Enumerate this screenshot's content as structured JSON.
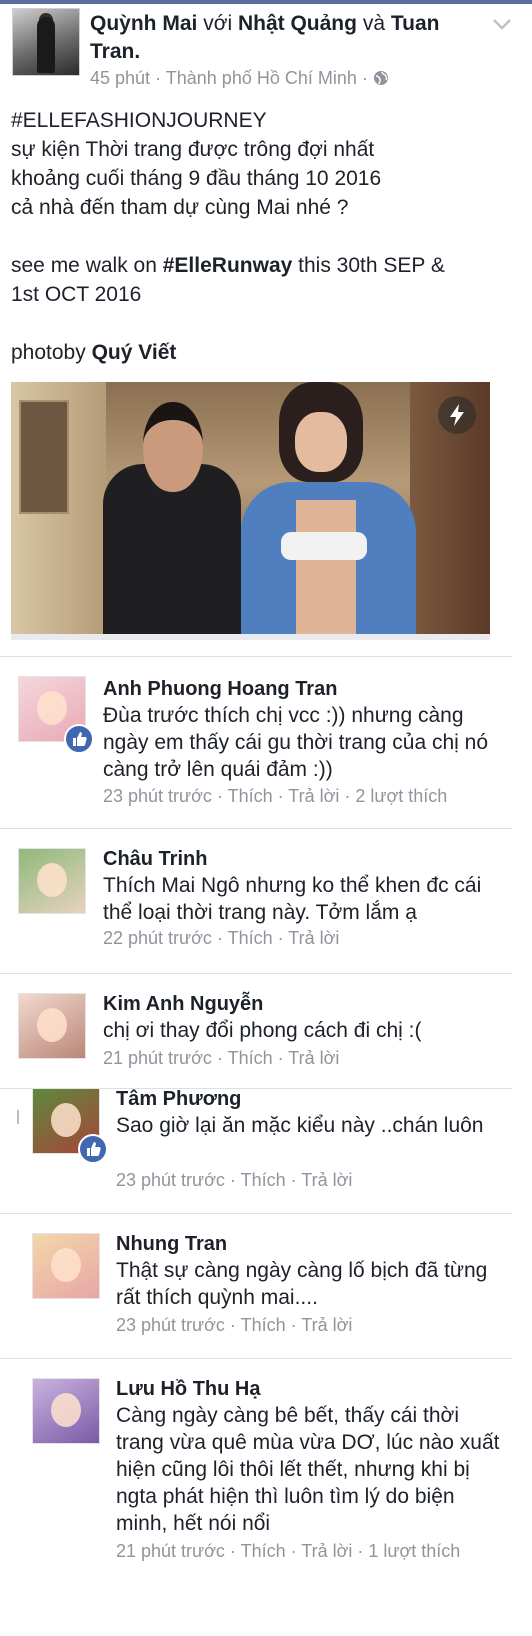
{
  "post": {
    "author": "Quỳnh Mai",
    "with_word": "với",
    "tagged_1": "Nhật Quảng",
    "and_word": "và",
    "tagged_2": "Tuan Tran.",
    "time": "45 phút",
    "dot": "·",
    "location": "Thành phố Hồ Chí Minh",
    "lines": [
      "#ELLEFASHIONJOURNEY",
      "sự kiện Thời trang được trông đợi nhất",
      "khoảng cuối tháng 9 đầu tháng 10 2016",
      "cả nhà đến tham dự cùng Mai nhé ?"
    ],
    "runway_prefix": "see me walk on",
    "runway_tag": "#ElleRunway",
    "runway_suffix": "this 30th SEP &",
    "runway_line2": "1st OCT 2016",
    "photo_prefix": "photoby",
    "photo_credit": "Quý Viết"
  },
  "comments": [
    {
      "name": "Anh Phuong Hoang Tran",
      "text": "Đùa trước thích chị vcc :)) nhưng càng ngày em thấy cái gu thời trang của chị nó càng trở lên quái đảm :))",
      "time": "23 phút trước",
      "like": "Thích",
      "reply": "Trả lời",
      "likes": "2 lượt thích",
      "colors": [
        "#f4d6dc",
        "#e9a9b6"
      ]
    },
    {
      "name": "Châu Trinh",
      "text": "Thích Mai Ngô nhưng ko thể khen đc cái thể loại thời trang này. Tởm lắm ạ",
      "time": "22 phút trước",
      "like": "Thích",
      "reply": "Trả lời",
      "colors": [
        "#8fb97a",
        "#e7d2c0"
      ]
    },
    {
      "name": "Kim Anh Nguyễn",
      "text": "chị ơi thay đổi phong cách đi chị :(",
      "time": "21 phút trước",
      "like": "Thích",
      "reply": "Trả lời",
      "colors": [
        "#f2d9cf",
        "#b98778"
      ]
    },
    {
      "name": "Tâm Phương",
      "text": "Sao giờ lại ăn mặc kiểu này ..chán luôn",
      "time": "23 phút trước",
      "like": "Thích",
      "reply": "Trả lời",
      "colors": [
        "#5d8a3c",
        "#a8443a"
      ]
    },
    {
      "name": "Nhung Tran",
      "text": "Thật sự càng ngày càng lố bịch đã từng rất thích quỳnh mai....",
      "time": "23 phút trước",
      "like": "Thích",
      "reply": "Trả lời",
      "colors": [
        "#f3d7a9",
        "#e8a6a6"
      ]
    },
    {
      "name": "Lưu Hồ Thu Hạ",
      "text": "Càng ngày càng bê bết, thấy cái thời trang vừa quê mùa vừa DƠ, lúc nào xuất hiện cũng lôi thôi lết thết, nhưng khi bị ngta phát hiện thì luôn tìm lý do biện minh, hết nói nổi",
      "time": "21 phút trước",
      "like": "Thích",
      "reply": "Trả lời",
      "likes": "1 lượt thích",
      "colors": [
        "#c9b3e0",
        "#7b5aa6"
      ]
    }
  ]
}
